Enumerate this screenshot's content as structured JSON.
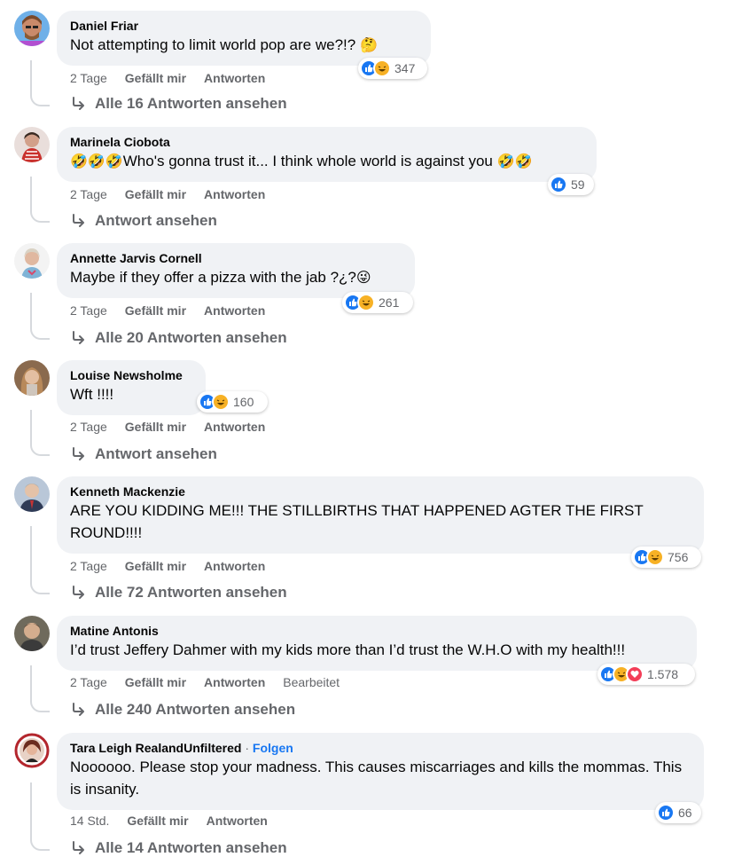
{
  "comments": [
    {
      "author": "Daniel Friar",
      "text": "Not attempting to limit world pop are we?!? ",
      "text_emoji": "🤔",
      "time": "2 Tage",
      "like": "Gefällt mir",
      "reply": "Antworten",
      "reaction_icons": [
        "like-icon",
        "laugh-icon"
      ],
      "reaction_count": "347",
      "replies_label": "Alle 16 Antworten ansehen"
    },
    {
      "author": "Marinela Ciobota",
      "text_emoji_prefix": "🤣🤣🤣",
      "text": "Who's gonna trust it... I think whole world is against you ",
      "text_emoji": "🤣🤣",
      "time": "2 Tage",
      "like": "Gefällt mir",
      "reply": "Antworten",
      "reaction_icons": [
        "like-icon"
      ],
      "reaction_count": "59",
      "replies_label": "Antwort ansehen"
    },
    {
      "author": "Annette Jarvis Cornell",
      "text": "Maybe if they offer a pizza with the jab ?¿?",
      "text_emoji": "😜",
      "time": "2 Tage",
      "like": "Gefällt mir",
      "reply": "Antworten",
      "reaction_icons": [
        "like-icon",
        "laugh-icon"
      ],
      "reaction_count": "261",
      "replies_label": "Alle 20 Antworten ansehen"
    },
    {
      "author": "Louise Newsholme",
      "text": "Wft !!!!",
      "time": "2 Tage",
      "like": "Gefällt mir",
      "reply": "Antworten",
      "reaction_icons": [
        "like-icon",
        "laugh-icon"
      ],
      "reaction_count": "160",
      "replies_label": "Antwort ansehen"
    },
    {
      "author": "Kenneth Mackenzie",
      "text": "ARE YOU KIDDING ME!!! THE STILLBIRTHS THAT HAPPENED AGTER THE FIRST ROUND!!!!",
      "time": "2 Tage",
      "like": "Gefällt mir",
      "reply": "Antworten",
      "reaction_icons": [
        "like-icon",
        "laugh-icon"
      ],
      "reaction_count": "756",
      "replies_label": "Alle 72 Antworten ansehen"
    },
    {
      "author": "Matine Antonis",
      "text": "I’d trust Jeffery Dahmer with my kids more than I’d trust the W.H.O with my health!!!",
      "time": "2 Tage",
      "like": "Gefällt mir",
      "reply": "Antworten",
      "edited": "Bearbeitet",
      "reaction_icons": [
        "like-icon",
        "laugh-icon",
        "love-icon"
      ],
      "reaction_count": "1.578",
      "replies_label": "Alle 240 Antworten ansehen"
    },
    {
      "author": "Tara Leigh RealandUnfiltered",
      "follow_separator": "·",
      "follow": "Folgen",
      "text": "Noooooo. Please stop your madness. This causes miscarriages and kills the mommas. This is insanity.",
      "time": "14 Std.",
      "like": "Gefällt mir",
      "reply": "Antworten",
      "reaction_icons": [
        "like-icon"
      ],
      "reaction_count": "66",
      "replies_label": "Alle 14 Antworten ansehen"
    }
  ],
  "colors": {
    "bubble": "#f0f2f5",
    "secondary_text": "#65676b",
    "like_blue": "#1877f2",
    "haha_yellow": "#f7b125",
    "love_red": "#f33e58",
    "thread_line": "#d6d9dd"
  }
}
